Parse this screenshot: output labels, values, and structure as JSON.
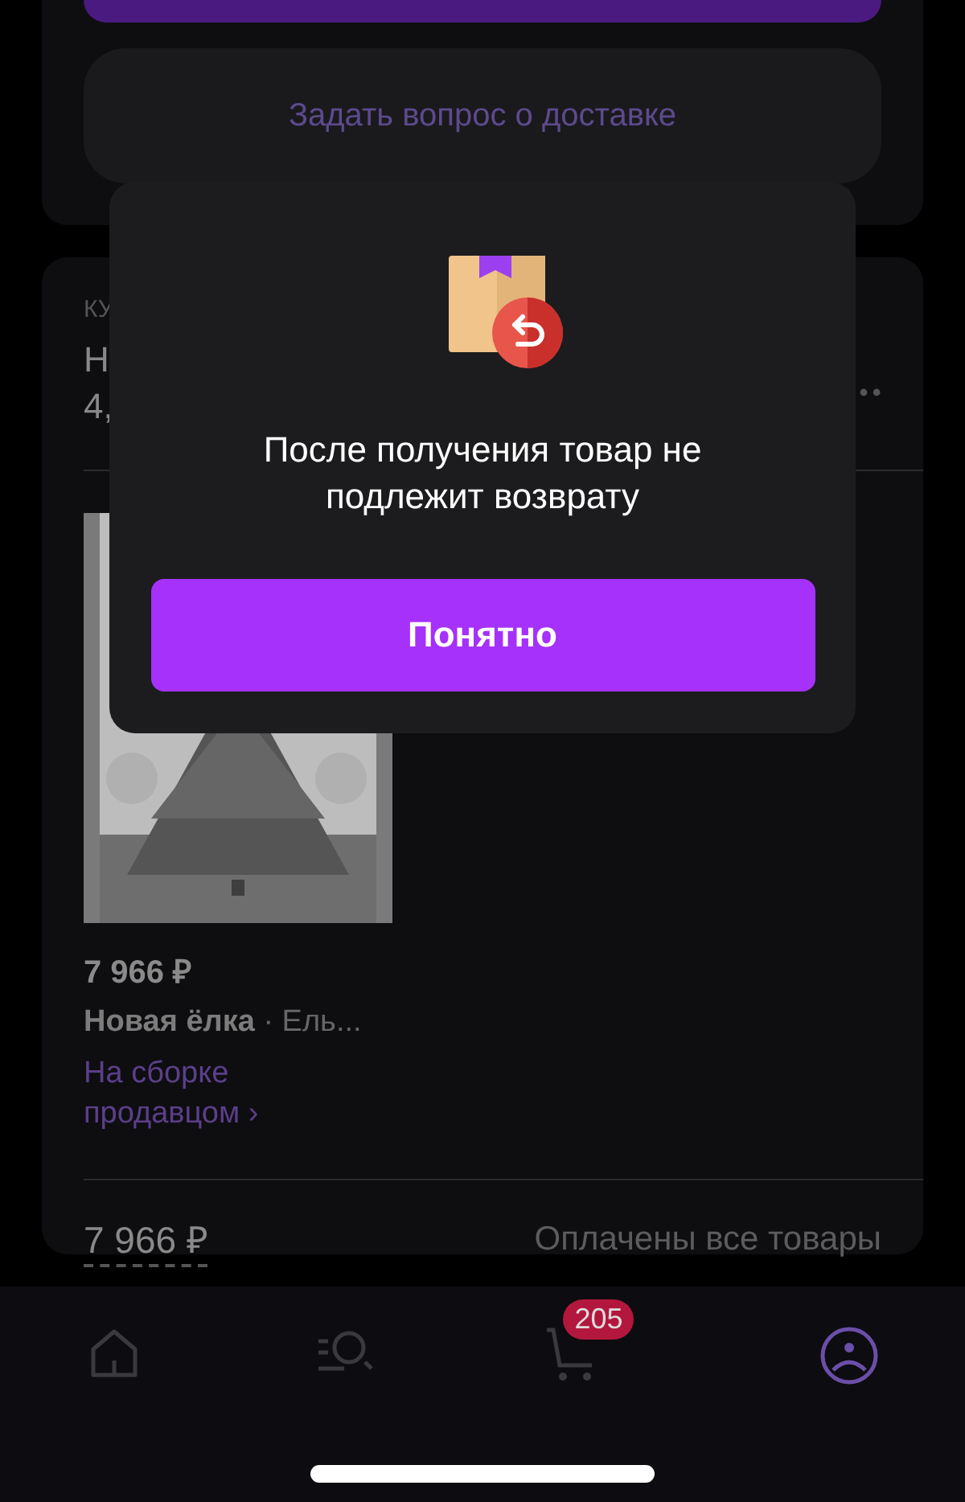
{
  "delivery_card": {
    "question_button": "Задать вопрос о доставке"
  },
  "order_card": {
    "label": "КУ",
    "heading_lines": [
      "Н",
      "4,"
    ],
    "item": {
      "kind": "picture",
      "price": "7 966 ₽",
      "name": "Новая ёлка",
      "detail": "· Ель...",
      "status": "На сборке продавцом ›"
    },
    "total": "7 966 ₽",
    "payment_status": "Оплачены все товары"
  },
  "modal": {
    "message": "После получения товар не подлежит возврату",
    "button": "Понятно"
  },
  "bottom_nav": [
    {
      "kind": "home",
      "selected": false
    },
    {
      "kind": "catalog",
      "selected": false
    },
    {
      "kind": "cart",
      "selected": false,
      "badge": "205"
    },
    {
      "kind": "profile",
      "selected": true
    }
  ]
}
